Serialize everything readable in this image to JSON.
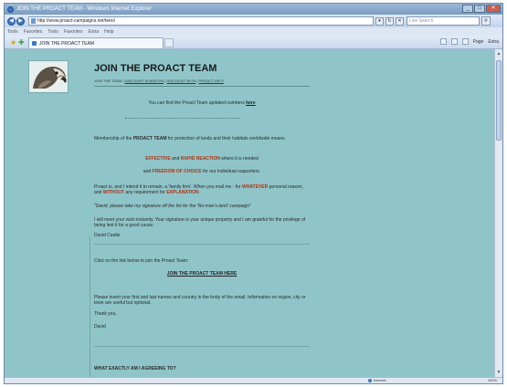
{
  "window": {
    "title": "JOIN THE PROACT TEAM - Windows Internet Explorer",
    "address": "http://www.proact-campaigns.net/teen/",
    "search_placeholder": "Live Search",
    "buttons": {
      "minimize": "_",
      "maximize": "□",
      "close": "✕"
    }
  },
  "menu": [
    "Tools",
    "Favorites",
    "Tools",
    "Favorites",
    "Extra",
    "Help"
  ],
  "tab": {
    "label": "JOIN THE PROACT TEAM"
  },
  "command_bar": {
    "page": "Page",
    "tools": "Extra"
  },
  "page": {
    "heading": "JOIN THE PROACT TEAM",
    "subnav": {
      "label": "JOIN THE TEAM",
      "links": [
        "DISCOUNT IN BASTINI",
        "DISCOUNT IN FA",
        "PROACT INFO"
      ],
      "sep": "|"
    },
    "updated_prefix": "You can find the Proact Team updated numbers",
    "updated_link": "here",
    "membership": {
      "prefix": "Membership of the",
      "team": "PROACT TEAM",
      "suffix": "for protection of lands and their habitats worldwide means"
    },
    "effective_line": {
      "a": "EFFECTIVE",
      "mid": "and",
      "b": "RAPID REACTION",
      "rest": "where it is needed"
    },
    "freedom_line": {
      "pre": "and",
      "b": "FREEDOM OF CHOICE",
      "rest": "for our individual supporters."
    },
    "para1": {
      "text": "Proact is, and I intend it to remain, a 'family firm'. When you mail me - for",
      "w": "WHATEVER",
      "mid": "personal reason, and",
      "wo": "WITHOUT",
      "mid2": "any requirement for",
      "exp": "EXPLANATION"
    },
    "quote": "\"David, please take my signature off the list for the 'No-man's-land' campaign\"",
    "para2": "I will meet your wish instantly. Your signature is your unique property and I am grateful for the privilege of being lent it for a good cause.",
    "sig1": "David Castle",
    "click_text": "Click on the link below to join the Proact Team:",
    "join_link": "JOIN THE PROACT TEAM HERE",
    "insert_text": "Please insert your first and last names and country in the body of the email. Information on region, city or town are useful but optional.",
    "thanks": "Thank you,",
    "sig2": "David",
    "what_heading": "WHAT EXACTLY AM I AGREEING TO?"
  },
  "status": {
    "zone": "Internet",
    "zoom": "100%"
  }
}
